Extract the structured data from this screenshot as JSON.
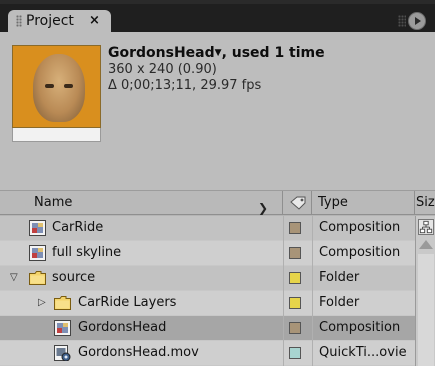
{
  "tab": {
    "title": "Project",
    "close": "×"
  },
  "preview": {
    "item_name": "GordonsHead",
    "usage": ", used 1 time",
    "dimensions": "360 x 240 (0.90)",
    "duration": "Δ 0;00;13;11, 29.97 fps"
  },
  "columns": {
    "name": "Name",
    "type": "Type",
    "size": "Size"
  },
  "rows": [
    {
      "name": "CarRide",
      "type": "Composition",
      "icon": "composition-icon",
      "label_color": "#a89478"
    },
    {
      "name": "full skyline",
      "type": "Composition",
      "icon": "composition-icon",
      "label_color": "#a89478"
    },
    {
      "name": "source",
      "type": "Folder",
      "icon": "folder-icon",
      "twisty": "▽",
      "label_color": "#e6d44a"
    },
    {
      "name": "CarRide Layers",
      "type": "Folder",
      "icon": "folder-icon",
      "twisty": "▷",
      "label_color": "#e6d44a"
    },
    {
      "name": "GordonsHead",
      "type": "Composition",
      "icon": "composition-icon",
      "label_color": "#a89478"
    },
    {
      "name": "GordonsHead.mov",
      "type": "QuickTi...ovie",
      "icon": "quicktime-file-icon",
      "label_color": "#a8d4d0"
    }
  ]
}
